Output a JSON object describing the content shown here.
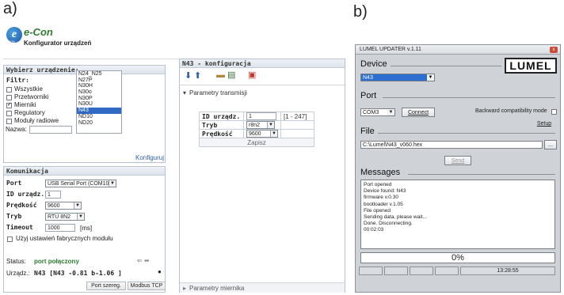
{
  "panel_labels": {
    "a": "a)",
    "b": "b)"
  },
  "econ": {
    "logo_sub": "CON",
    "app_name": "e-Con",
    "app_subtitle": "Konfigurator urządzeń",
    "device_box": {
      "title": "Wybierz urządzenie:",
      "filter_label": "Filtr:",
      "filters": [
        {
          "label": "Wszystkie",
          "checked": false
        },
        {
          "label": "Przetworniki",
          "checked": false
        },
        {
          "label": "Mierniki",
          "checked": true
        },
        {
          "label": "Regulatory",
          "checked": false
        },
        {
          "label": "Moduły radiowe",
          "checked": false
        }
      ],
      "name_label": "Nazwa:",
      "name_value": "",
      "devices": [
        "N24_N25",
        "N27P",
        "N30H",
        "N30o",
        "N30P",
        "N30U",
        "N43",
        "ND10",
        "ND20"
      ],
      "selected_device": "N43",
      "configure_link": "Konfiguruj"
    },
    "comm_box": {
      "title": "Komunikacja",
      "port_label": "Port",
      "port_value": "USB Serial Port (COM10)",
      "id_label": "ID urządz.",
      "id_value": "1",
      "speed_label": "Prędkość",
      "speed_value": "9600",
      "mode_label": "Tryb",
      "mode_value": "RTU 8N2",
      "timeout_label": "Timeout",
      "timeout_value": "1000",
      "timeout_unit": "[ms]",
      "factory_label": "Użyj ustawień fabrycznych modułu",
      "factory_checked": false
    },
    "status": {
      "status_label": "Status:",
      "status_value": "port połączony",
      "device_label": "Urządz.:",
      "device_value": "N43 [N43 -0.81 b-1.06 ]",
      "btn_port": "Port szereg.",
      "btn_modbus": "Modbus TCP"
    },
    "config": {
      "title": "N43 - konfiguracja",
      "section_transmission": "Parametry transmisji",
      "params": [
        {
          "key": "ID urządz.",
          "value": "1",
          "range": "[1 - 247]",
          "type": "input"
        },
        {
          "key": "Tryb",
          "value": "r8n2",
          "range": "",
          "type": "select"
        },
        {
          "key": "Prędkość",
          "value": "9600",
          "range": "",
          "type": "select"
        }
      ],
      "save_button": "Zapisz",
      "section_meter": "Parametry miernika"
    }
  },
  "lumel": {
    "title": "LUMEL UPDATER v.1.11",
    "close_glyph": "x",
    "logo_text": "LUMEL",
    "device_head": "Device",
    "device_value": "N43",
    "port_head": "Port",
    "port_value": "COM3",
    "connect_label": "Connect",
    "backward_label": "Backward compatibility mode",
    "setup_label": "Setup",
    "file_head": "File",
    "file_value": "C:\\Lumel\\N43_v060.hex",
    "browse_label": "...",
    "send_label": "Send",
    "messages_head": "Messages",
    "messages": [
      "Port opened",
      "Device found: N43",
      " firmware v.0.30",
      " bootloader v.1.05",
      "File opened",
      "Sending data, please wait...",
      "Done. Disconnecting.",
      "00:02:03"
    ],
    "progress_text": "0%",
    "status_time": "13:28:55"
  }
}
